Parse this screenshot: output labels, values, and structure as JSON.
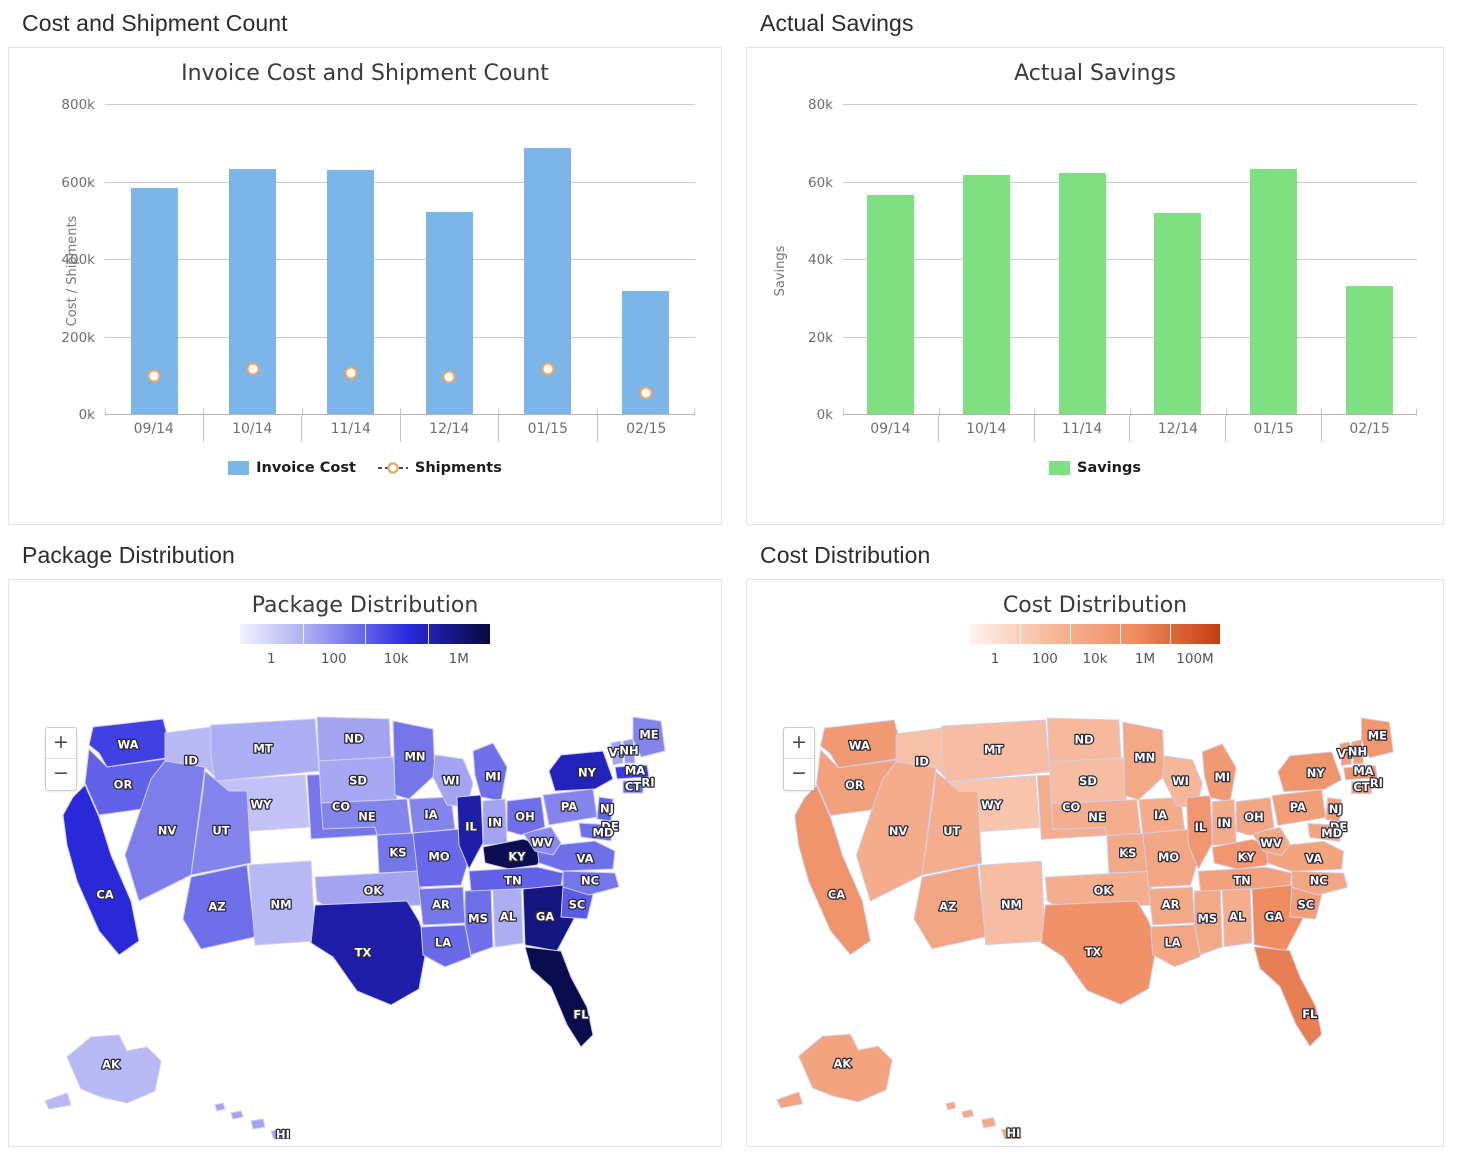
{
  "panels": {
    "cost_shipment": {
      "heading": "Cost and Shipment Count"
    },
    "actual_savings": {
      "heading": "Actual Savings"
    },
    "package_distribution": {
      "heading": "Package Distribution"
    },
    "cost_distribution": {
      "heading": "Cost Distribution"
    }
  },
  "map_controls": {
    "zoom_in": "+",
    "zoom_out": "−"
  },
  "colors": {
    "bar_blue": "#7cb5e8",
    "bar_green": "#7ee080",
    "line_dark": "#26303a",
    "marker_fill": "#ffffff",
    "marker_stroke": "#f0a460",
    "package_scale_low": "#f2f2fd",
    "package_scale_high": "#07083a",
    "cost_scale_low": "#fdf3ee",
    "cost_scale_high": "#c43d10"
  },
  "chart_data": [
    {
      "type": "bar",
      "id": "invoice-cost-shipment-count",
      "title": "Invoice Cost and Shipment Count",
      "xlabel": "",
      "ylabel": "Cost / Shipments",
      "categories": [
        "09/14",
        "10/14",
        "11/14",
        "12/14",
        "01/15",
        "02/15"
      ],
      "ylim": [
        0,
        800000
      ],
      "yticks": [
        0,
        200000,
        400000,
        600000,
        800000
      ],
      "ytick_labels": [
        "0k",
        "200k",
        "400k",
        "600k",
        "800k"
      ],
      "grid": true,
      "legend_position": "bottom",
      "series": [
        {
          "name": "Invoice Cost",
          "chart_type": "bar",
          "color": "#7cb5e8",
          "values": [
            584000,
            633000,
            630000,
            522000,
            687000,
            318000
          ]
        },
        {
          "name": "Shipments",
          "chart_type": "line",
          "color": "#26303a",
          "values": [
            98000,
            117000,
            107000,
            95000,
            115000,
            55000
          ]
        }
      ]
    },
    {
      "type": "bar",
      "id": "actual-savings",
      "title": "Actual Savings",
      "xlabel": "",
      "ylabel": "Savings",
      "categories": [
        "09/14",
        "10/14",
        "11/14",
        "12/14",
        "01/15",
        "02/15"
      ],
      "ylim": [
        0,
        80000
      ],
      "yticks": [
        0,
        20000,
        40000,
        60000,
        80000
      ],
      "ytick_labels": [
        "0k",
        "20k",
        "40k",
        "60k",
        "80k"
      ],
      "grid": true,
      "legend_position": "bottom",
      "series": [
        {
          "name": "Savings",
          "chart_type": "bar",
          "color": "#7ee080",
          "values": [
            56500,
            61800,
            62300,
            52000,
            63200,
            33000
          ]
        }
      ]
    },
    {
      "type": "heatmap",
      "id": "package-distribution-map",
      "title": "Package Distribution",
      "map": "united-states-choropleth",
      "legend_ticks": [
        "1",
        "100",
        "10k",
        "1M"
      ],
      "legend_scale": "log",
      "legend_colors": [
        "#f2f2fd",
        "#9a9af0",
        "#2a2ae0",
        "#07083a"
      ],
      "states": [
        {
          "code": "WA",
          "level": 0.6
        },
        {
          "code": "OR",
          "level": 0.5
        },
        {
          "code": "CA",
          "level": 0.68
        },
        {
          "code": "NV",
          "level": 0.42
        },
        {
          "code": "ID",
          "level": 0.22
        },
        {
          "code": "MT",
          "level": 0.26
        },
        {
          "code": "WY",
          "level": 0.18
        },
        {
          "code": "UT",
          "level": 0.4
        },
        {
          "code": "AZ",
          "level": 0.46
        },
        {
          "code": "NM",
          "level": 0.22
        },
        {
          "code": "CO",
          "level": 0.44
        },
        {
          "code": "ND",
          "level": 0.3
        },
        {
          "code": "SD",
          "level": 0.28
        },
        {
          "code": "NE",
          "level": 0.4
        },
        {
          "code": "KS",
          "level": 0.44
        },
        {
          "code": "OK",
          "level": 0.3
        },
        {
          "code": "TX",
          "level": 0.78
        },
        {
          "code": "MN",
          "level": 0.44
        },
        {
          "code": "IA",
          "level": 0.4
        },
        {
          "code": "MO",
          "level": 0.48
        },
        {
          "code": "AR",
          "level": 0.44
        },
        {
          "code": "LA",
          "level": 0.48
        },
        {
          "code": "WI",
          "level": 0.3
        },
        {
          "code": "IL",
          "level": 0.78
        },
        {
          "code": "MS",
          "level": 0.46
        },
        {
          "code": "AL",
          "level": 0.26
        },
        {
          "code": "MI",
          "level": 0.46
        },
        {
          "code": "IN",
          "level": 0.3
        },
        {
          "code": "KY",
          "level": 0.95
        },
        {
          "code": "TN",
          "level": 0.5
        },
        {
          "code": "GA",
          "level": 0.86
        },
        {
          "code": "FL",
          "level": 0.96
        },
        {
          "code": "SC",
          "level": 0.52
        },
        {
          "code": "NC",
          "level": 0.44
        },
        {
          "code": "VA",
          "level": 0.46
        },
        {
          "code": "WV",
          "level": 0.38
        },
        {
          "code": "OH",
          "level": 0.46
        },
        {
          "code": "PA",
          "level": 0.4
        },
        {
          "code": "NY",
          "level": 0.74
        },
        {
          "code": "VT",
          "level": 0.3
        },
        {
          "code": "NH",
          "level": 0.34
        },
        {
          "code": "ME",
          "level": 0.4
        },
        {
          "code": "MA",
          "level": 0.62
        },
        {
          "code": "RI",
          "level": 0.42
        },
        {
          "code": "CT",
          "level": 0.48
        },
        {
          "code": "NJ",
          "level": 0.5
        },
        {
          "code": "DE",
          "level": 0.46
        },
        {
          "code": "MD",
          "level": 0.46
        },
        {
          "code": "AK",
          "level": 0.22
        },
        {
          "code": "HI",
          "level": 0.3
        }
      ]
    },
    {
      "type": "heatmap",
      "id": "cost-distribution-map",
      "title": "Cost Distribution",
      "map": "united-states-choropleth",
      "legend_ticks": [
        "1",
        "100",
        "10k",
        "1M",
        "100M"
      ],
      "legend_scale": "log",
      "legend_colors": [
        "#fdf3ee",
        "#f6b799",
        "#ef8b5f",
        "#c43d10"
      ],
      "states": [
        {
          "code": "WA",
          "level": 0.56
        },
        {
          "code": "OR",
          "level": 0.5
        },
        {
          "code": "CA",
          "level": 0.6
        },
        {
          "code": "NV",
          "level": 0.42
        },
        {
          "code": "ID",
          "level": 0.28
        },
        {
          "code": "MT",
          "level": 0.3
        },
        {
          "code": "WY",
          "level": 0.26
        },
        {
          "code": "UT",
          "level": 0.4
        },
        {
          "code": "AZ",
          "level": 0.46
        },
        {
          "code": "NM",
          "level": 0.3
        },
        {
          "code": "CO",
          "level": 0.4
        },
        {
          "code": "ND",
          "level": 0.32
        },
        {
          "code": "SD",
          "level": 0.3
        },
        {
          "code": "NE",
          "level": 0.4
        },
        {
          "code": "KS",
          "level": 0.44
        },
        {
          "code": "OK",
          "level": 0.4
        },
        {
          "code": "TX",
          "level": 0.62
        },
        {
          "code": "MN",
          "level": 0.44
        },
        {
          "code": "IA",
          "level": 0.42
        },
        {
          "code": "MO",
          "level": 0.46
        },
        {
          "code": "AR",
          "level": 0.44
        },
        {
          "code": "LA",
          "level": 0.46
        },
        {
          "code": "WI",
          "level": 0.34
        },
        {
          "code": "IL",
          "level": 0.58
        },
        {
          "code": "MS",
          "level": 0.44
        },
        {
          "code": "AL",
          "level": 0.4
        },
        {
          "code": "MI",
          "level": 0.56
        },
        {
          "code": "IN",
          "level": 0.42
        },
        {
          "code": "KY",
          "level": 0.58
        },
        {
          "code": "TN",
          "level": 0.5
        },
        {
          "code": "GA",
          "level": 0.66
        },
        {
          "code": "FL",
          "level": 0.72
        },
        {
          "code": "SC",
          "level": 0.52
        },
        {
          "code": "NC",
          "level": 0.46
        },
        {
          "code": "VA",
          "level": 0.48
        },
        {
          "code": "WV",
          "level": 0.44
        },
        {
          "code": "OH",
          "level": 0.46
        },
        {
          "code": "PA",
          "level": 0.52
        },
        {
          "code": "NY",
          "level": 0.6
        },
        {
          "code": "VT",
          "level": 0.52
        },
        {
          "code": "NH",
          "level": 0.5
        },
        {
          "code": "ME",
          "level": 0.58
        },
        {
          "code": "MA",
          "level": 0.58
        },
        {
          "code": "RI",
          "level": 0.5
        },
        {
          "code": "CT",
          "level": 0.52
        },
        {
          "code": "NJ",
          "level": 0.52
        },
        {
          "code": "DE",
          "level": 0.48
        },
        {
          "code": "MD",
          "level": 0.48
        },
        {
          "code": "AK",
          "level": 0.48
        },
        {
          "code": "HI",
          "level": 0.44
        }
      ]
    }
  ]
}
